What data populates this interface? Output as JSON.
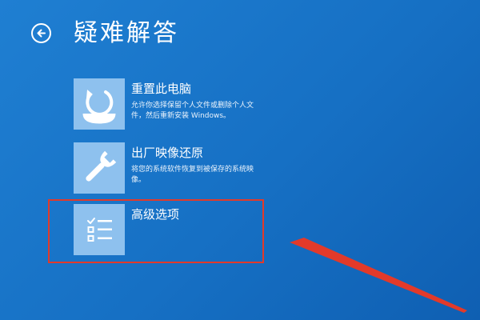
{
  "header": {
    "back_icon": "back-arrow-circle-icon",
    "title": "疑难解答"
  },
  "options": [
    {
      "icon": "reset-refresh-icon",
      "title": "重置此电脑",
      "description": "允许你选择保留个人文件或删除个人文件，然后重新安装 Windows。"
    },
    {
      "icon": "wrench-icon",
      "title": "出厂映像还原",
      "description": "将您的系统软件恢复到被保存的系统映像。"
    },
    {
      "icon": "checklist-icon",
      "title": "高级选项",
      "description": ""
    }
  ],
  "annotation": {
    "highlight_color": "#e23a2a",
    "arrow_color": "#e23a2a"
  },
  "colors": {
    "background": "#1670c4",
    "tile": "#8ec1ee",
    "text": "#ffffff"
  }
}
